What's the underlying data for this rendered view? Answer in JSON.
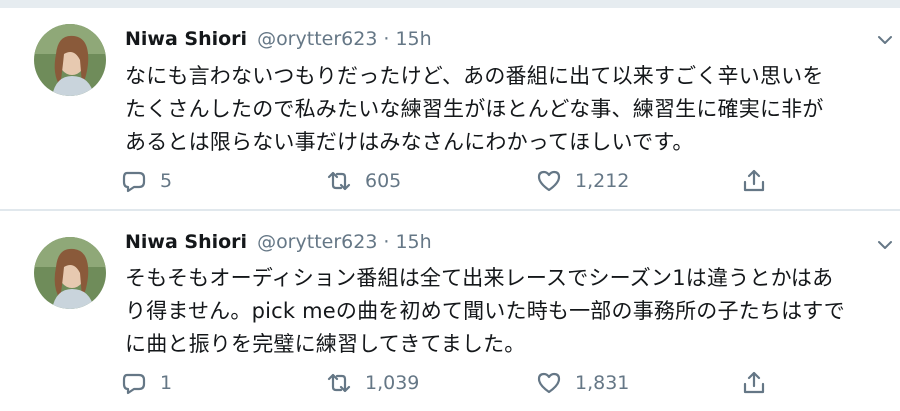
{
  "tweets": [
    {
      "name": "Niwa Shiori",
      "handle": "@orytter623",
      "separator": "·",
      "time": "15h",
      "lines": [
        "なにも言わないつもりだったけど、あの番組に出て以来すごく辛い思いを",
        "たくさんしたので私みたいな練習生がほとんどな事、練習生に確実に非が",
        "あるとは限らない事だけはみなさんにわかってほしいです。"
      ],
      "replies": "5",
      "retweets": "605",
      "likes": "1,212"
    },
    {
      "name": "Niwa Shiori",
      "handle": "@orytter623",
      "separator": "·",
      "time": "15h",
      "lines": [
        "そもそもオーディション番組は全て出来レースでシーズン1は違うとかはあ",
        "り得ません。pick meの曲を初めて聞いた時も一部の事務所の子たちはすで",
        "に曲と振りを完璧に練習してきてました。"
      ],
      "replies": "1",
      "retweets": "1,039",
      "likes": "1,831"
    }
  ],
  "icons": {
    "reply": "reply-icon",
    "retweet": "retweet-icon",
    "like": "heart-icon",
    "share": "share-icon",
    "caret": "chevron-down-icon",
    "avatar": "avatar"
  },
  "colors": {
    "text": "#14171a",
    "secondary": "#657786",
    "divider": "#e1e8ed"
  }
}
